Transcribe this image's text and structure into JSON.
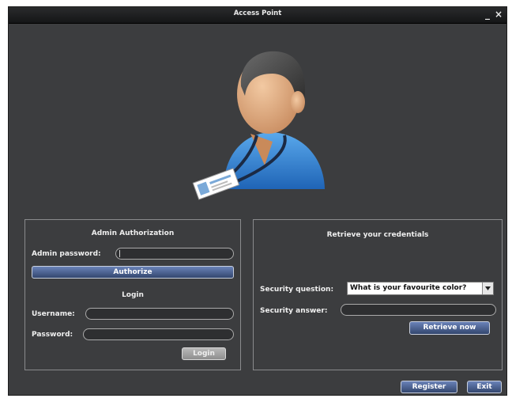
{
  "window": {
    "title": "Access Point",
    "minimize": "_",
    "close": "×"
  },
  "admin": {
    "heading": "Admin Authorization",
    "password_label": "Admin password:",
    "authorize_label": "Authorize"
  },
  "login": {
    "heading": "Login",
    "username_label": "Username:",
    "password_label": "Password:",
    "login_label": "Login"
  },
  "retrieve": {
    "heading": "Retrieve your credentials",
    "question_label": "Security question:",
    "question_value": "What is your favourite color?",
    "answer_label": "Security answer:",
    "retrieve_label": "Retrieve now"
  },
  "footer": {
    "register_label": "Register",
    "exit_label": "Exit"
  },
  "icons": {
    "avatar": "user-with-badge-icon",
    "dropdown": "chevron-down-icon"
  }
}
